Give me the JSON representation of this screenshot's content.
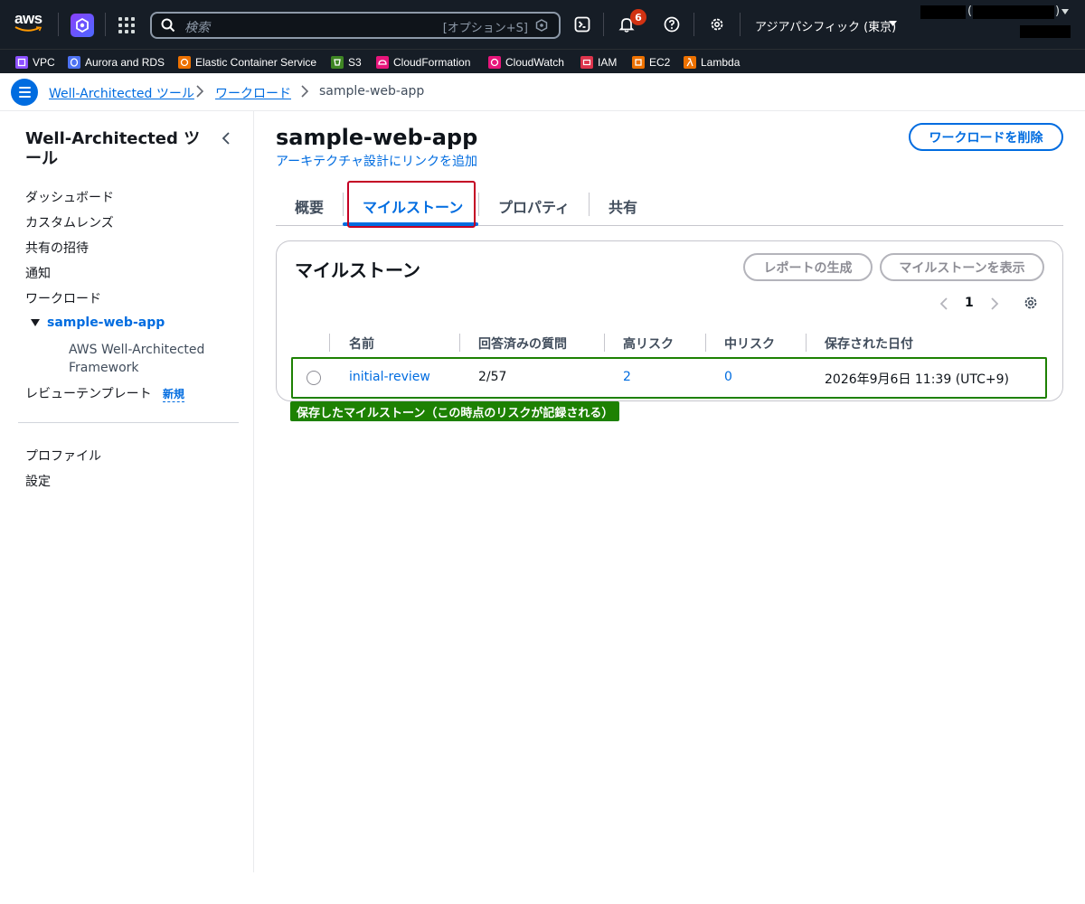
{
  "topnav": {
    "aws_logo": "aws",
    "search": {
      "placeholder": "検索",
      "shortcut": "[オプション+S]"
    },
    "notifications_count": "6",
    "region": "アジアパシフィック (東京)",
    "icons": [
      "aws-logo",
      "q-icon",
      "apps-grid-icon",
      "search-icon",
      "cloudshell-icon",
      "bell-icon",
      "help-icon",
      "gear-icon",
      "caret-down-icon"
    ]
  },
  "favorites": [
    {
      "label": "VPC",
      "color": "#8c4fff"
    },
    {
      "label": "Aurora and RDS",
      "color": "#4d72f3"
    },
    {
      "label": "Elastic Container Service",
      "color": "#ed7100"
    },
    {
      "label": "S3",
      "color": "#3f8624"
    },
    {
      "label": "CloudFormation",
      "color": "#e7157b"
    },
    {
      "label": "CloudWatch",
      "color": "#e7157b"
    },
    {
      "label": "IAM",
      "color": "#dd344c"
    },
    {
      "label": "EC2",
      "color": "#ed7100"
    },
    {
      "label": "Lambda",
      "color": "#ed7100"
    }
  ],
  "breadcrumb": {
    "items": [
      "Well-Architected ツール",
      "ワークロード"
    ],
    "current": "sample-web-app"
  },
  "sidenav": {
    "title": "Well-Architected ツール",
    "items": [
      "ダッシュボード",
      "カスタムレンズ",
      "共有の招待",
      "通知",
      "ワークロード"
    ],
    "workload": "sample-web-app",
    "workload_child": "AWS Well-Architected Framework",
    "review_templates": "レビューテンプレート",
    "new_badge": "新規",
    "bottom_items": [
      "プロファイル",
      "設定"
    ]
  },
  "main": {
    "title": "sample-web-app",
    "architecture_link": "アーキテクチャ設計にリンクを追加",
    "delete_button": "ワークロードを削除",
    "tabs": [
      "概要",
      "マイルストーン",
      "プロパティ",
      "共有"
    ],
    "active_tab": "マイルストーン"
  },
  "milestones": {
    "title": "マイルストーン",
    "generate_report": "レポートの生成",
    "view_milestone": "マイルストーンを表示",
    "page": "1",
    "columns": [
      "名前",
      "回答済みの質問",
      "高リスク",
      "中リスク",
      "保存された日付"
    ],
    "rows": [
      {
        "name": "initial-review",
        "answered": "2/57",
        "high_risk": "2",
        "medium_risk": "0",
        "saved": "2026年9月6日 11:39 (UTC+9)"
      }
    ]
  },
  "annotation": "保存したマイルストーン（この時点のリスクが記録される）",
  "colors": {
    "nav_bg": "#161d26",
    "link": "#006ce0",
    "highlight_red": "#c40024",
    "highlight_green": "#1d8102"
  }
}
